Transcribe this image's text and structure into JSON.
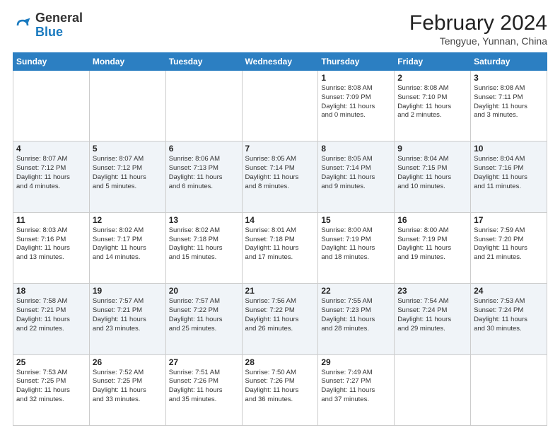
{
  "header": {
    "logo_general": "General",
    "logo_blue": "Blue",
    "month_year": "February 2024",
    "location": "Tengyue, Yunnan, China"
  },
  "days_of_week": [
    "Sunday",
    "Monday",
    "Tuesday",
    "Wednesday",
    "Thursday",
    "Friday",
    "Saturday"
  ],
  "weeks": [
    [
      {
        "day": "",
        "info": ""
      },
      {
        "day": "",
        "info": ""
      },
      {
        "day": "",
        "info": ""
      },
      {
        "day": "",
        "info": ""
      },
      {
        "day": "1",
        "info": "Sunrise: 8:08 AM\nSunset: 7:09 PM\nDaylight: 11 hours\nand 0 minutes."
      },
      {
        "day": "2",
        "info": "Sunrise: 8:08 AM\nSunset: 7:10 PM\nDaylight: 11 hours\nand 2 minutes."
      },
      {
        "day": "3",
        "info": "Sunrise: 8:08 AM\nSunset: 7:11 PM\nDaylight: 11 hours\nand 3 minutes."
      }
    ],
    [
      {
        "day": "4",
        "info": "Sunrise: 8:07 AM\nSunset: 7:12 PM\nDaylight: 11 hours\nand 4 minutes."
      },
      {
        "day": "5",
        "info": "Sunrise: 8:07 AM\nSunset: 7:12 PM\nDaylight: 11 hours\nand 5 minutes."
      },
      {
        "day": "6",
        "info": "Sunrise: 8:06 AM\nSunset: 7:13 PM\nDaylight: 11 hours\nand 6 minutes."
      },
      {
        "day": "7",
        "info": "Sunrise: 8:05 AM\nSunset: 7:14 PM\nDaylight: 11 hours\nand 8 minutes."
      },
      {
        "day": "8",
        "info": "Sunrise: 8:05 AM\nSunset: 7:14 PM\nDaylight: 11 hours\nand 9 minutes."
      },
      {
        "day": "9",
        "info": "Sunrise: 8:04 AM\nSunset: 7:15 PM\nDaylight: 11 hours\nand 10 minutes."
      },
      {
        "day": "10",
        "info": "Sunrise: 8:04 AM\nSunset: 7:16 PM\nDaylight: 11 hours\nand 11 minutes."
      }
    ],
    [
      {
        "day": "11",
        "info": "Sunrise: 8:03 AM\nSunset: 7:16 PM\nDaylight: 11 hours\nand 13 minutes."
      },
      {
        "day": "12",
        "info": "Sunrise: 8:02 AM\nSunset: 7:17 PM\nDaylight: 11 hours\nand 14 minutes."
      },
      {
        "day": "13",
        "info": "Sunrise: 8:02 AM\nSunset: 7:18 PM\nDaylight: 11 hours\nand 15 minutes."
      },
      {
        "day": "14",
        "info": "Sunrise: 8:01 AM\nSunset: 7:18 PM\nDaylight: 11 hours\nand 17 minutes."
      },
      {
        "day": "15",
        "info": "Sunrise: 8:00 AM\nSunset: 7:19 PM\nDaylight: 11 hours\nand 18 minutes."
      },
      {
        "day": "16",
        "info": "Sunrise: 8:00 AM\nSunset: 7:19 PM\nDaylight: 11 hours\nand 19 minutes."
      },
      {
        "day": "17",
        "info": "Sunrise: 7:59 AM\nSunset: 7:20 PM\nDaylight: 11 hours\nand 21 minutes."
      }
    ],
    [
      {
        "day": "18",
        "info": "Sunrise: 7:58 AM\nSunset: 7:21 PM\nDaylight: 11 hours\nand 22 minutes."
      },
      {
        "day": "19",
        "info": "Sunrise: 7:57 AM\nSunset: 7:21 PM\nDaylight: 11 hours\nand 23 minutes."
      },
      {
        "day": "20",
        "info": "Sunrise: 7:57 AM\nSunset: 7:22 PM\nDaylight: 11 hours\nand 25 minutes."
      },
      {
        "day": "21",
        "info": "Sunrise: 7:56 AM\nSunset: 7:22 PM\nDaylight: 11 hours\nand 26 minutes."
      },
      {
        "day": "22",
        "info": "Sunrise: 7:55 AM\nSunset: 7:23 PM\nDaylight: 11 hours\nand 28 minutes."
      },
      {
        "day": "23",
        "info": "Sunrise: 7:54 AM\nSunset: 7:24 PM\nDaylight: 11 hours\nand 29 minutes."
      },
      {
        "day": "24",
        "info": "Sunrise: 7:53 AM\nSunset: 7:24 PM\nDaylight: 11 hours\nand 30 minutes."
      }
    ],
    [
      {
        "day": "25",
        "info": "Sunrise: 7:53 AM\nSunset: 7:25 PM\nDaylight: 11 hours\nand 32 minutes."
      },
      {
        "day": "26",
        "info": "Sunrise: 7:52 AM\nSunset: 7:25 PM\nDaylight: 11 hours\nand 33 minutes."
      },
      {
        "day": "27",
        "info": "Sunrise: 7:51 AM\nSunset: 7:26 PM\nDaylight: 11 hours\nand 35 minutes."
      },
      {
        "day": "28",
        "info": "Sunrise: 7:50 AM\nSunset: 7:26 PM\nDaylight: 11 hours\nand 36 minutes."
      },
      {
        "day": "29",
        "info": "Sunrise: 7:49 AM\nSunset: 7:27 PM\nDaylight: 11 hours\nand 37 minutes."
      },
      {
        "day": "",
        "info": ""
      },
      {
        "day": "",
        "info": ""
      }
    ]
  ]
}
